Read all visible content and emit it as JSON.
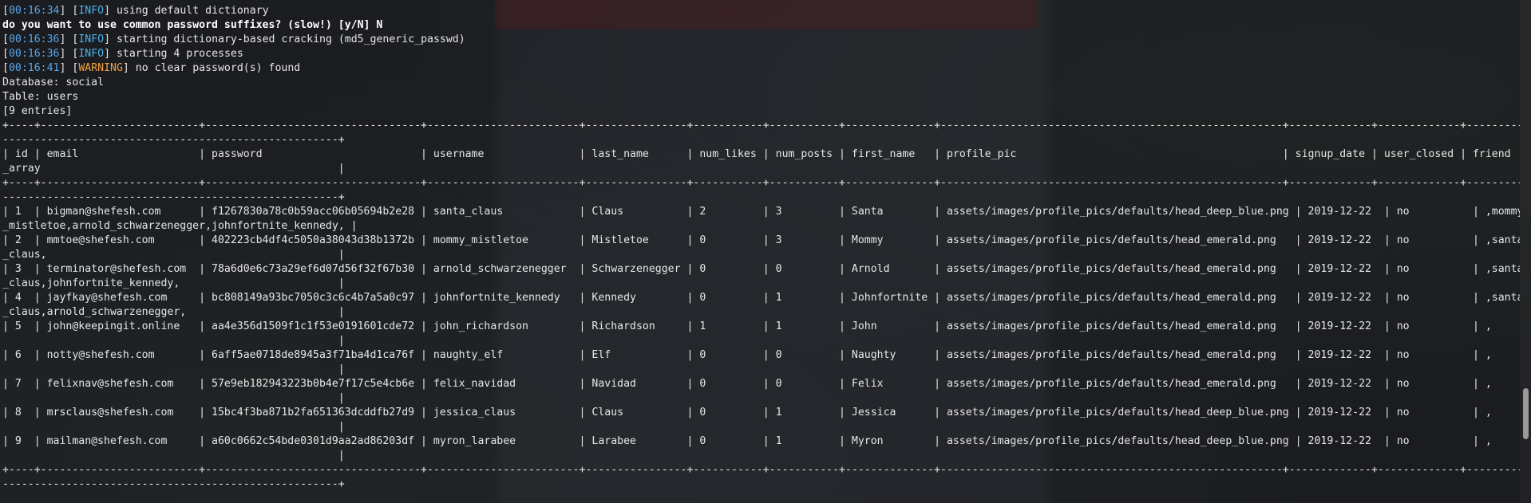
{
  "log": [
    {
      "time": "00:16:34",
      "level": "INFO",
      "msg": " using default dictionary"
    },
    {
      "prompt": "do you want to use common password suffixes? (slow!) [y/N] N"
    },
    {
      "time": "00:16:36",
      "level": "INFO",
      "msg": " starting dictionary-based cracking (md5_generic_passwd)"
    },
    {
      "time": "00:16:36",
      "level": "INFO",
      "msg": " starting 4 processes"
    },
    {
      "time": "00:16:41",
      "level": "WARNING",
      "msg": " no clear password(s) found"
    }
  ],
  "meta": {
    "database": "Database: social",
    "table": "Table: users",
    "entries": "[9 entries]"
  },
  "table_lines": [
    "+----+-------------------------+----------------------------------+------------------------+----------------+-----------+-----------+--------------+------------------------------------------------------+-------------+-------------+----------------",
    "-----------------------------------------------------+",
    "| id | email                   | password                         | username               | last_name      | num_likes | num_posts | first_name   | profile_pic                                          | signup_date | user_closed | friend",
    "_array                                               |",
    "+----+-------------------------+----------------------------------+------------------------+----------------+-----------+-----------+--------------+------------------------------------------------------+-------------+-------------+----------------",
    "-----------------------------------------------------+",
    "| 1  | bigman@shefesh.com      | f1267830a78c0b59acc06b05694b2e28 | santa_claus            | Claus          | 2         | 3         | Santa        | assets/images/profile_pics/defaults/head_deep_blue.png | 2019-12-22  | no          | ,mommy",
    "_mistletoe,arnold_schwarzenegger,johnfortnite_kennedy, |",
    "| 2  | mmtoe@shefesh.com       | 402223cb4df4c5050a38043d38b1372b | mommy_mistletoe        | Mistletoe      | 0         | 3         | Mommy        | assets/images/profile_pics/defaults/head_emerald.png   | 2019-12-22  | no          | ,santa",
    "_claus,                                              |",
    "| 3  | terminator@shefesh.com  | 78a6d0e6c73a29ef6d07d56f32f67b30 | arnold_schwarzenegger  | Schwarzenegger | 0         | 0         | Arnold       | assets/images/profile_pics/defaults/head_emerald.png   | 2019-12-22  | no          | ,santa",
    "_claus,johnfortnite_kennedy,                         |",
    "| 4  | jayfkay@shefesh.com     | bc808149a93bc7050c3c6c4b7a5a0c97 | johnfortnite_kennedy   | Kennedy        | 0         | 1         | Johnfortnite | assets/images/profile_pics/defaults/head_emerald.png   | 2019-12-22  | no          | ,santa",
    "_claus,arnold_schwarzenegger,                        |",
    "| 5  | john@keepingit.online   | aa4e356d1509f1c1f53e0191601cde72 | john_richardson        | Richardson     | 1         | 1         | John         | assets/images/profile_pics/defaults/head_emerald.png   | 2019-12-22  | no          | ,",
    "                                                     |",
    "| 6  | notty@shefesh.com       | 6aff5ae0718de8945a3f71ba4d1ca76f | naughty_elf            | Elf            | 0         | 0         | Naughty      | assets/images/profile_pics/defaults/head_emerald.png   | 2019-12-22  | no          | ,",
    "                                                     |",
    "| 7  | felixnav@shefesh.com    | 57e9eb182943223b0b4e7f17c5e4cb6e | felix_navidad          | Navidad        | 0         | 0         | Felix        | assets/images/profile_pics/defaults/head_emerald.png   | 2019-12-22  | no          | ,",
    "                                                     |",
    "| 8  | mrsclaus@shefesh.com    | 15bc4f3ba871b2fa651363dcddfb27d9 | jessica_claus          | Claus          | 0         | 1         | Jessica      | assets/images/profile_pics/defaults/head_deep_blue.png | 2019-12-22  | no          | ,",
    "                                                     |",
    "| 9  | mailman@shefesh.com     | a60c0662c54bde0301d9aa2ad86203df | myron_larabee          | Larabee        | 0         | 1         | Myron        | assets/images/profile_pics/defaults/head_deep_blue.png | 2019-12-22  | no          | ,",
    "                                                     |",
    "+----+-------------------------+----------------------------------+------------------------+----------------+-----------+-----------+--------------+------------------------------------------------------+-------------+-------------+----------------",
    "-----------------------------------------------------+"
  ],
  "colors": {
    "background": "#16181c",
    "text": "#e6e6e6",
    "timestamp": "#58a6e8",
    "info": "#4fb0e6",
    "warning": "#f0a040"
  }
}
